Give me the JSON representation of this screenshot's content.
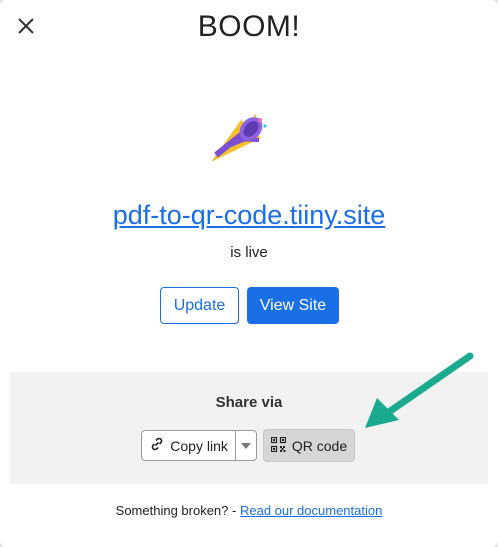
{
  "modal": {
    "title": "BOOM!",
    "site_url": "pdf-to-qr-code.tiiny.site",
    "status_text": "is live",
    "update_label": "Update",
    "view_site_label": "View Site"
  },
  "share": {
    "title": "Share via",
    "copy_link_label": "Copy link",
    "qr_code_label": "QR code"
  },
  "footer": {
    "prefix": "Something broken? -",
    "doc_link_label": "Read our documentation"
  },
  "colors": {
    "accent": "#1a6fe6",
    "arrow": "#1aab8f"
  },
  "icons": {
    "close": "close-icon",
    "celebration": "party-popper-icon",
    "link": "link-icon",
    "caret": "caret-down-icon",
    "qr": "qr-code-icon",
    "annotation": "arrow-annotation-icon"
  }
}
